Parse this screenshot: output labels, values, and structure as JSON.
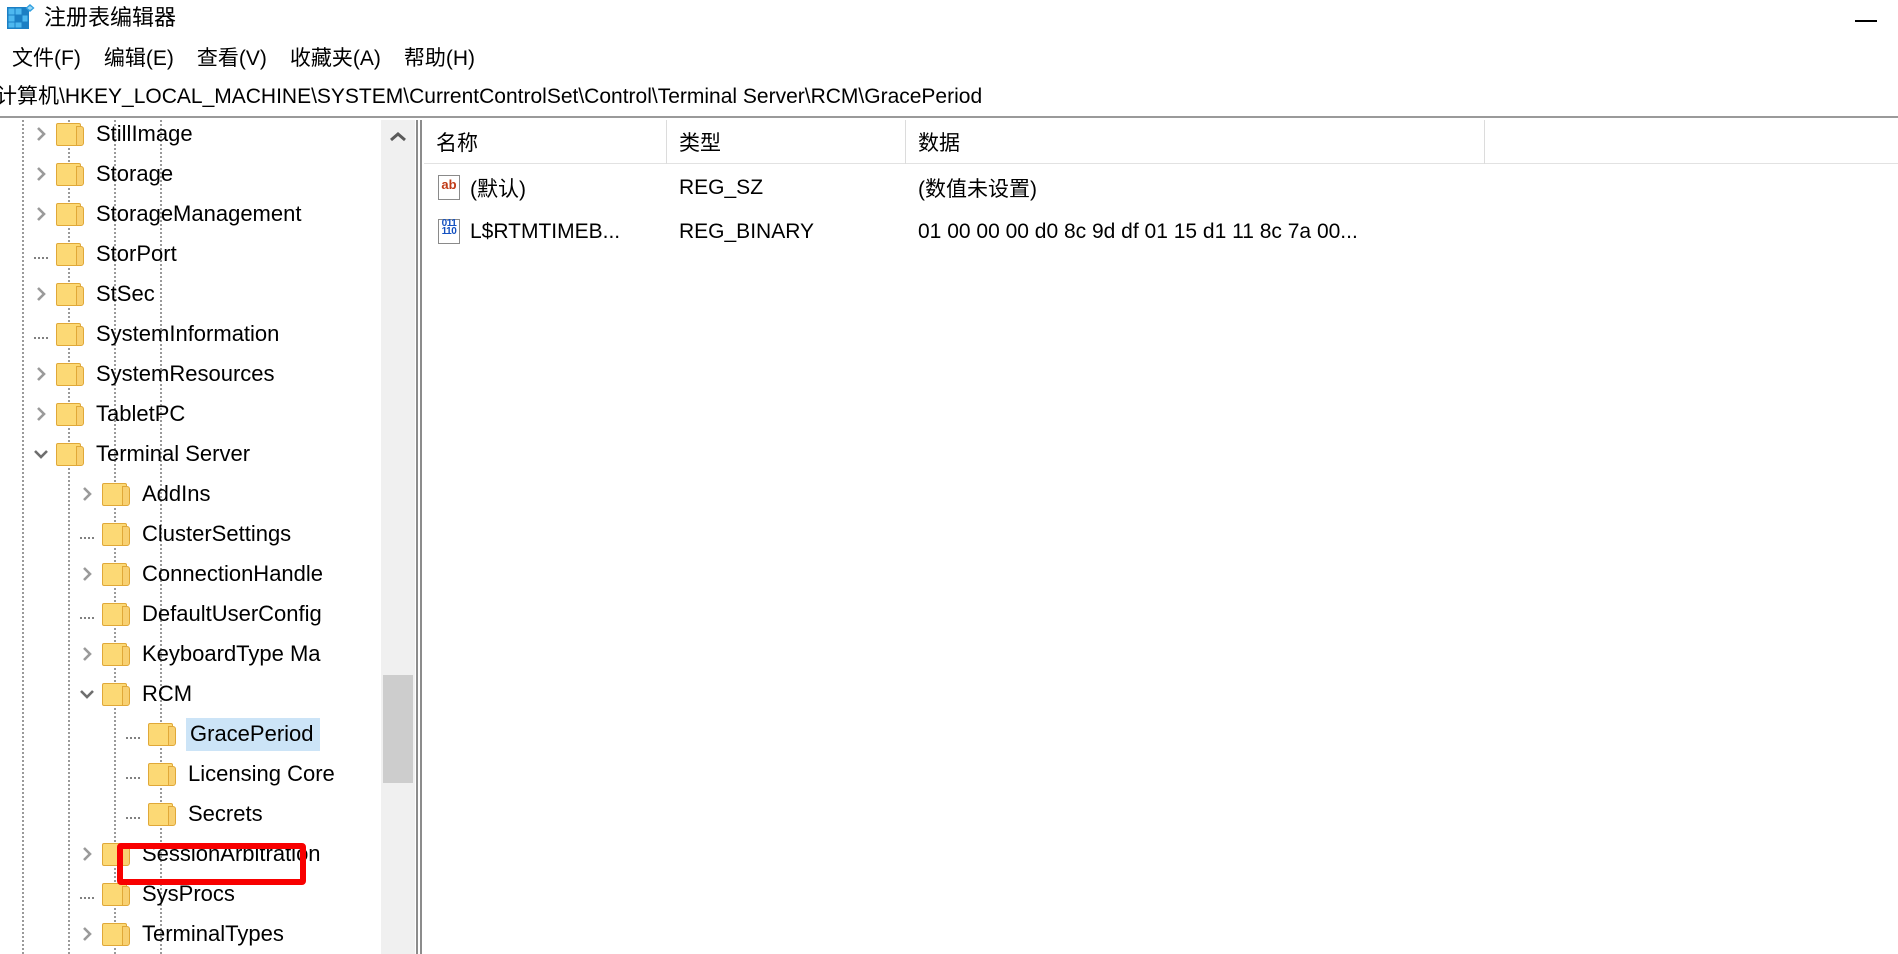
{
  "window": {
    "title": "注册表编辑器",
    "app_icon": "registry-grid-icon",
    "minimize_label": "最小化"
  },
  "menubar": {
    "items": [
      {
        "label": "文件(F)"
      },
      {
        "label": "编辑(E)"
      },
      {
        "label": "查看(V)"
      },
      {
        "label": "收藏夹(A)"
      },
      {
        "label": "帮助(H)"
      }
    ]
  },
  "address": {
    "path": "计算机\\HKEY_LOCAL_MACHINE\\SYSTEM\\CurrentControlSet\\Control\\Terminal Server\\RCM\\GracePeriod"
  },
  "tree": {
    "nodes": [
      {
        "label": "StillImage",
        "indent": 1,
        "expander": "collapsed",
        "selected": false
      },
      {
        "label": "Storage",
        "indent": 1,
        "expander": "collapsed",
        "selected": false
      },
      {
        "label": "StorageManagement",
        "indent": 1,
        "expander": "collapsed",
        "selected": false
      },
      {
        "label": "StorPort",
        "indent": 1,
        "expander": "leaf",
        "selected": false
      },
      {
        "label": "StSec",
        "indent": 1,
        "expander": "collapsed",
        "selected": false
      },
      {
        "label": "SystemInformation",
        "indent": 1,
        "expander": "leaf",
        "selected": false
      },
      {
        "label": "SystemResources",
        "indent": 1,
        "expander": "collapsed",
        "selected": false
      },
      {
        "label": "TabletPC",
        "indent": 1,
        "expander": "collapsed",
        "selected": false
      },
      {
        "label": "Terminal Server",
        "indent": 1,
        "expander": "expanded",
        "selected": false
      },
      {
        "label": "AddIns",
        "indent": 2,
        "expander": "collapsed",
        "selected": false
      },
      {
        "label": "ClusterSettings",
        "indent": 2,
        "expander": "leaf",
        "selected": false
      },
      {
        "label": "ConnectionHandle",
        "indent": 2,
        "expander": "collapsed",
        "selected": false
      },
      {
        "label": "DefaultUserConfig",
        "indent": 2,
        "expander": "leaf",
        "selected": false
      },
      {
        "label": "KeyboardType Ma",
        "indent": 2,
        "expander": "collapsed",
        "selected": false
      },
      {
        "label": "RCM",
        "indent": 2,
        "expander": "expanded",
        "selected": false
      },
      {
        "label": "GracePeriod",
        "indent": 3,
        "expander": "leaf",
        "selected": true
      },
      {
        "label": "Licensing Core",
        "indent": 3,
        "expander": "leaf",
        "selected": false
      },
      {
        "label": "Secrets",
        "indent": 3,
        "expander": "leaf",
        "selected": false
      },
      {
        "label": "SessionArbitration",
        "indent": 2,
        "expander": "collapsed",
        "selected": false
      },
      {
        "label": "SysProcs",
        "indent": 2,
        "expander": "leaf",
        "selected": false
      },
      {
        "label": "TerminalTypes",
        "indent": 2,
        "expander": "collapsed",
        "selected": false
      }
    ],
    "scroll_up_icon": "chevron-up-icon",
    "highlight_color": "#f80000",
    "selection_color": "#cce4f7"
  },
  "list": {
    "columns": [
      {
        "label": "名称"
      },
      {
        "label": "类型"
      },
      {
        "label": "数据"
      }
    ],
    "rows": [
      {
        "icon": "string-value-icon",
        "icon_text": "ab",
        "name": "(默认)",
        "type": "REG_SZ",
        "data": "(数值未设置)"
      },
      {
        "icon": "binary-value-icon",
        "icon_text": "011\n110",
        "name": "L$RTMTIMEB...",
        "type": "REG_BINARY",
        "data": "01 00 00 00 d0 8c 9d df 01 15 d1 11 8c 7a 00..."
      }
    ]
  }
}
